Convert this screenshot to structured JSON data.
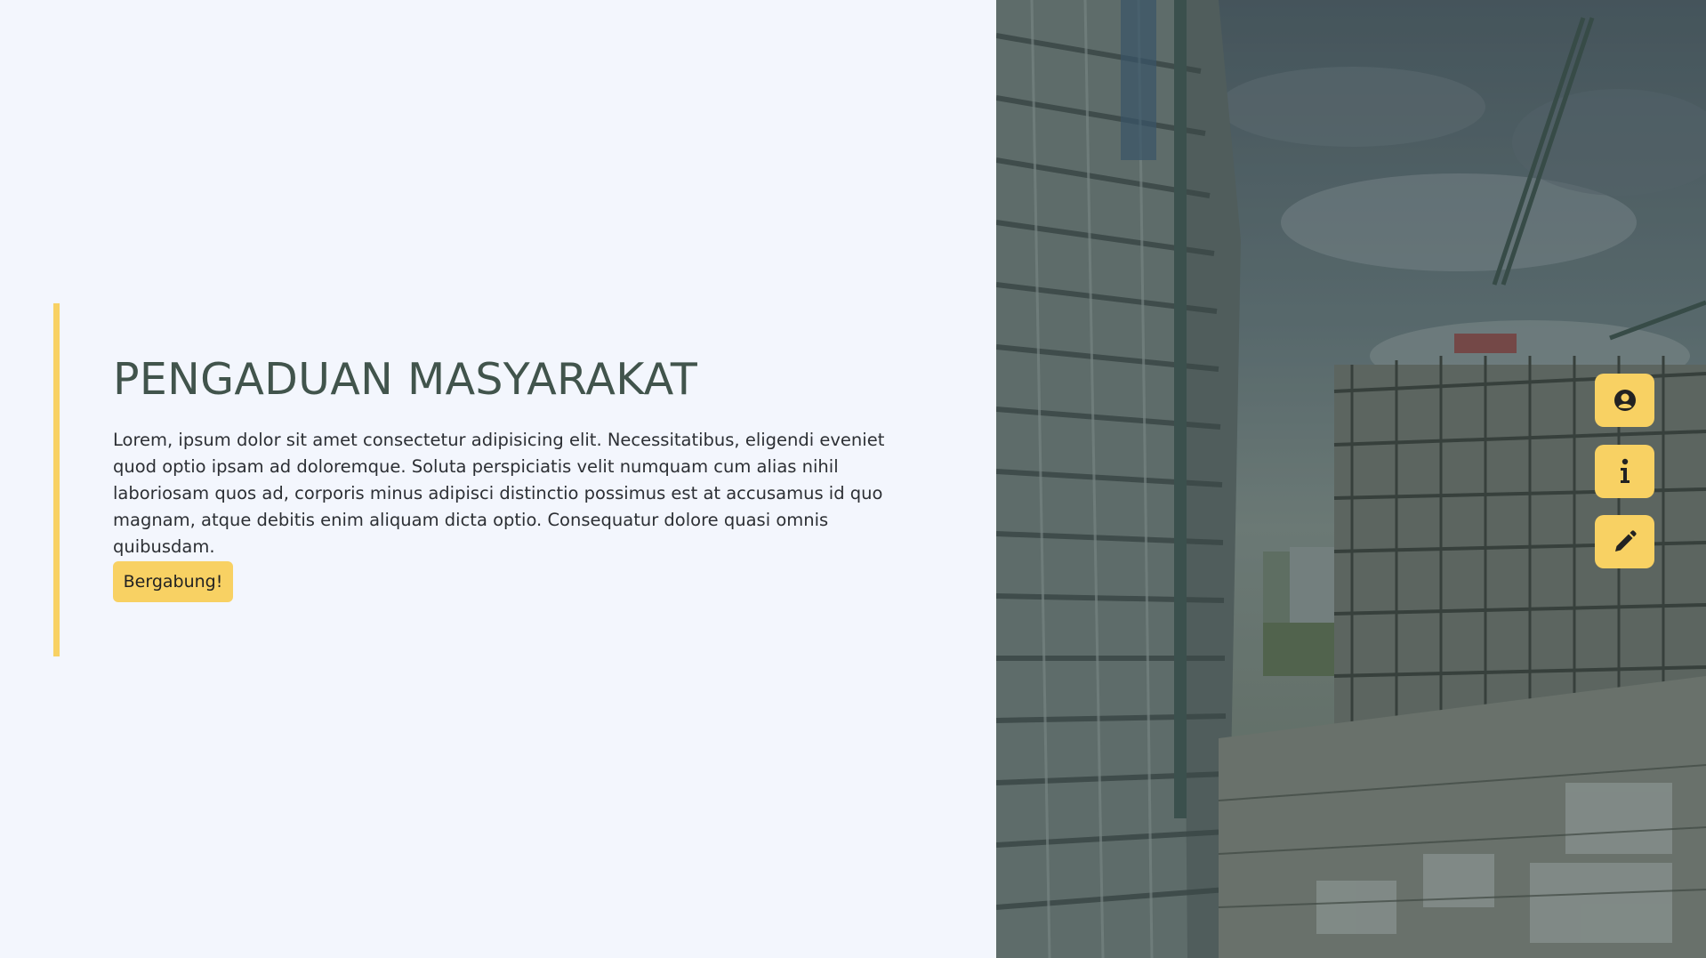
{
  "hero": {
    "title": "PENGADUAN MASYARAKAT",
    "description": "Lorem, ipsum dolor sit amet consectetur adipisicing elit. Necessitatibus, eligendi eveniet quod optio ipsam ad doloremque. Soluta perspiciatis velit numquam cum alias nihil laboriosam quos ad, corporis minus adipisci distinctio possimus est at accusamus id quo magnam, atque debitis enim aliquam dicta optio. Consequatur dolore quasi omnis quibusdam.",
    "button_label": "Bergabung!"
  },
  "floating_menu": [
    {
      "icon": "user-circle-icon"
    },
    {
      "icon": "info-icon"
    },
    {
      "icon": "pencil-icon"
    }
  ],
  "colors": {
    "accent": "#f8d163",
    "background": "#f3f6fd",
    "title": "#41544c"
  }
}
